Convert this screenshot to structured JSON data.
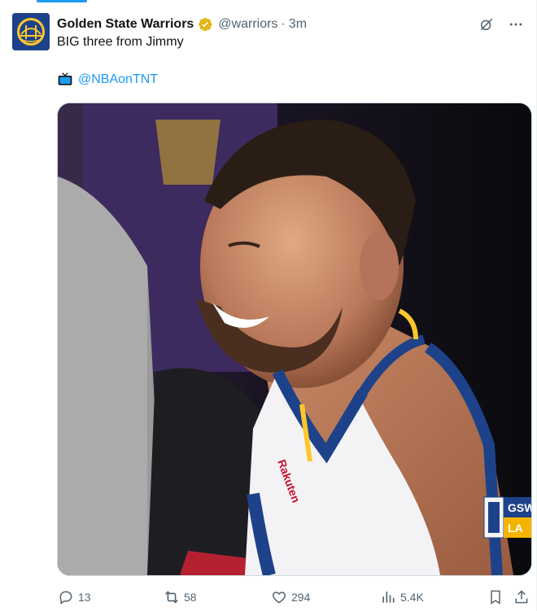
{
  "account": {
    "name": "Golden State Warriors",
    "handle": "@warriors",
    "separator": "·",
    "time": "3m",
    "avatar_icon": "warriors-bridge-logo",
    "verified_icon": "gold-verified-badge",
    "brand_color": "#1d428a",
    "badge_color": "#e2b719"
  },
  "tweet": {
    "text": "BIG three from Jimmy",
    "mention_icon": "tv-icon",
    "mention": "@NBAonTNT"
  },
  "media": {
    "type": "video-still",
    "description_icon": "player-celebration-frame",
    "score_bug": {
      "team_top": "GSW",
      "team_bottom": "LA"
    }
  },
  "header_actions": [
    {
      "icon": "grok-icon"
    },
    {
      "icon": "more-icon"
    }
  ],
  "actions": {
    "reply": {
      "icon": "reply-icon",
      "count": "13"
    },
    "repost": {
      "icon": "repost-icon",
      "count": "58"
    },
    "like": {
      "icon": "like-icon",
      "count": "294"
    },
    "views": {
      "icon": "views-icon",
      "count": "5.4K"
    },
    "bookmark": {
      "icon": "bookmark-icon"
    },
    "share": {
      "icon": "share-icon"
    }
  },
  "colors": {
    "link": "#1d9bf0",
    "muted": "#536471",
    "text": "#0f1419"
  }
}
